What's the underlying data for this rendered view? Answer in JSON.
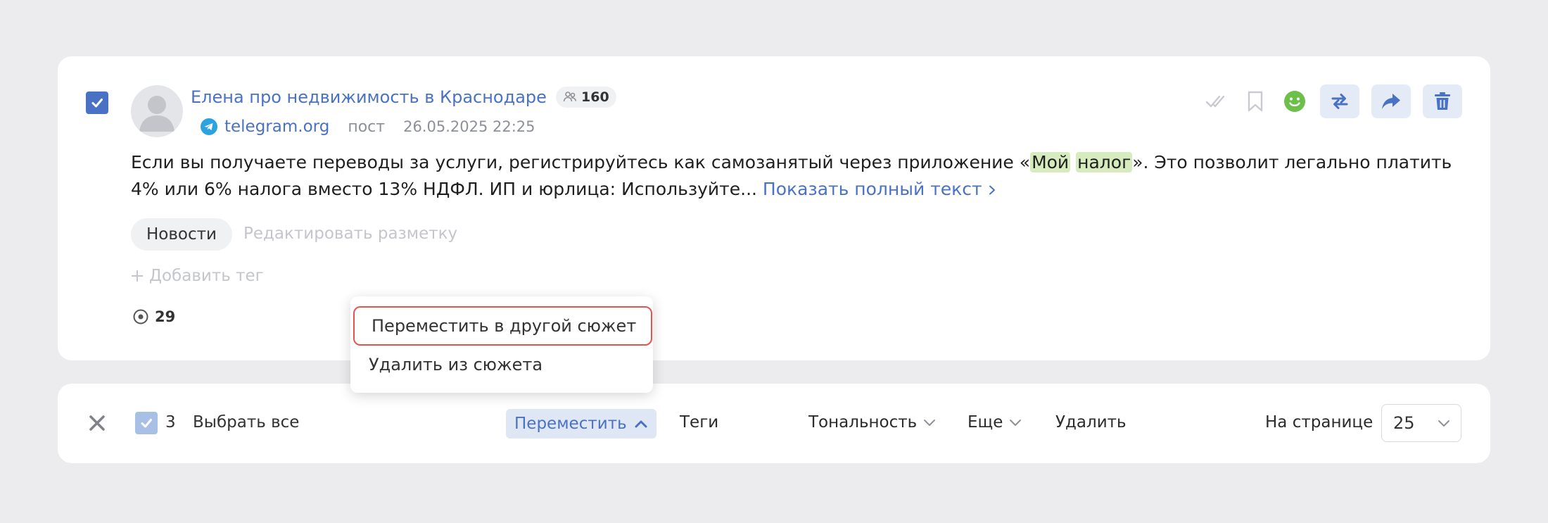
{
  "post": {
    "author": "Елена про недвижимость в Краснодаре",
    "subscribers": "160",
    "source": "telegram.org",
    "type": "пост",
    "date": "26.05.2025 22:25",
    "text_before": "Если вы получаете переводы за услуги, регистрируйтесь как самозанятый через приложение «",
    "highlight_1": "Мой",
    "highlight_2": "налог",
    "text_after": "». Это позволит легально платить 4% или 6% налога вместо 13% НДФЛ. ИП и юрлица: Используйте... ",
    "show_full": "Показать полный текст",
    "tag": "Новости",
    "edit_markup": "Редактировать разметку",
    "add_tag": "Добавить тег",
    "views": "29",
    "checked": true
  },
  "actions": {
    "icons": [
      "check-icon",
      "bookmark-icon",
      "sentiment-positive-icon",
      "swap-icon",
      "share-icon",
      "trash-icon"
    ]
  },
  "bulk_bar": {
    "selected_count": "3",
    "select_all": "Выбрать все",
    "move": "Переместить",
    "tags": "Теги",
    "tonality": "Тональность",
    "more": "Еще",
    "delete": "Удалить",
    "per_page_label": "На странице",
    "per_page_value": "25"
  },
  "move_menu": {
    "items": [
      "Переместить в другой сюжет",
      "Удалить из сюжета"
    ]
  },
  "colors": {
    "accent": "#4a72c4",
    "highlight": "#d6ecbf",
    "positive": "#6cc04a",
    "danger_outline": "#e5534b"
  }
}
